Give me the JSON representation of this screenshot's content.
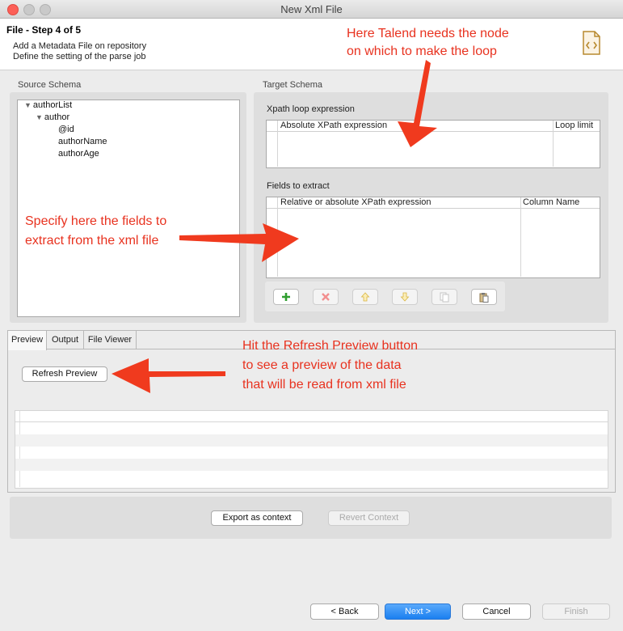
{
  "window": {
    "title": "New Xml File"
  },
  "header": {
    "step": "File - Step 4 of 5",
    "line1": "Add a Metadata File on repository",
    "line2": "Define the setting of the parse job"
  },
  "source_schema": {
    "label": "Source Schema",
    "tree": [
      "authorList",
      "author",
      "@id",
      "authorName",
      "authorAge"
    ]
  },
  "target_schema": {
    "label": "Target Schema",
    "xpath_loop_label": "Xpath loop expression",
    "loop_columns": [
      "Absolute XPath expression",
      "Loop limit"
    ],
    "fields_label": "Fields to extract",
    "field_columns": [
      "Relative or absolute XPath expression",
      "Column Name"
    ]
  },
  "tabs": [
    "Preview",
    "Output",
    "File Viewer"
  ],
  "preview": {
    "refresh_label": "Refresh Preview"
  },
  "context": {
    "export_label": "Export as context",
    "revert_label": "Revert Context"
  },
  "nav": {
    "back": "< Back",
    "next": "Next >",
    "cancel": "Cancel",
    "finish": "Finish"
  },
  "annotations": {
    "loop": [
      "Here Talend needs the node",
      "on which to make the loop"
    ],
    "fields": [
      "Specify here the fields to",
      "extract from the xml file"
    ],
    "refresh": [
      "Hit the Refresh Preview button",
      "to see a preview of the data",
      "that will be read from xml file"
    ]
  },
  "colors": {
    "annotation": "#e8321f",
    "primary_button": "#1a7ff0"
  }
}
